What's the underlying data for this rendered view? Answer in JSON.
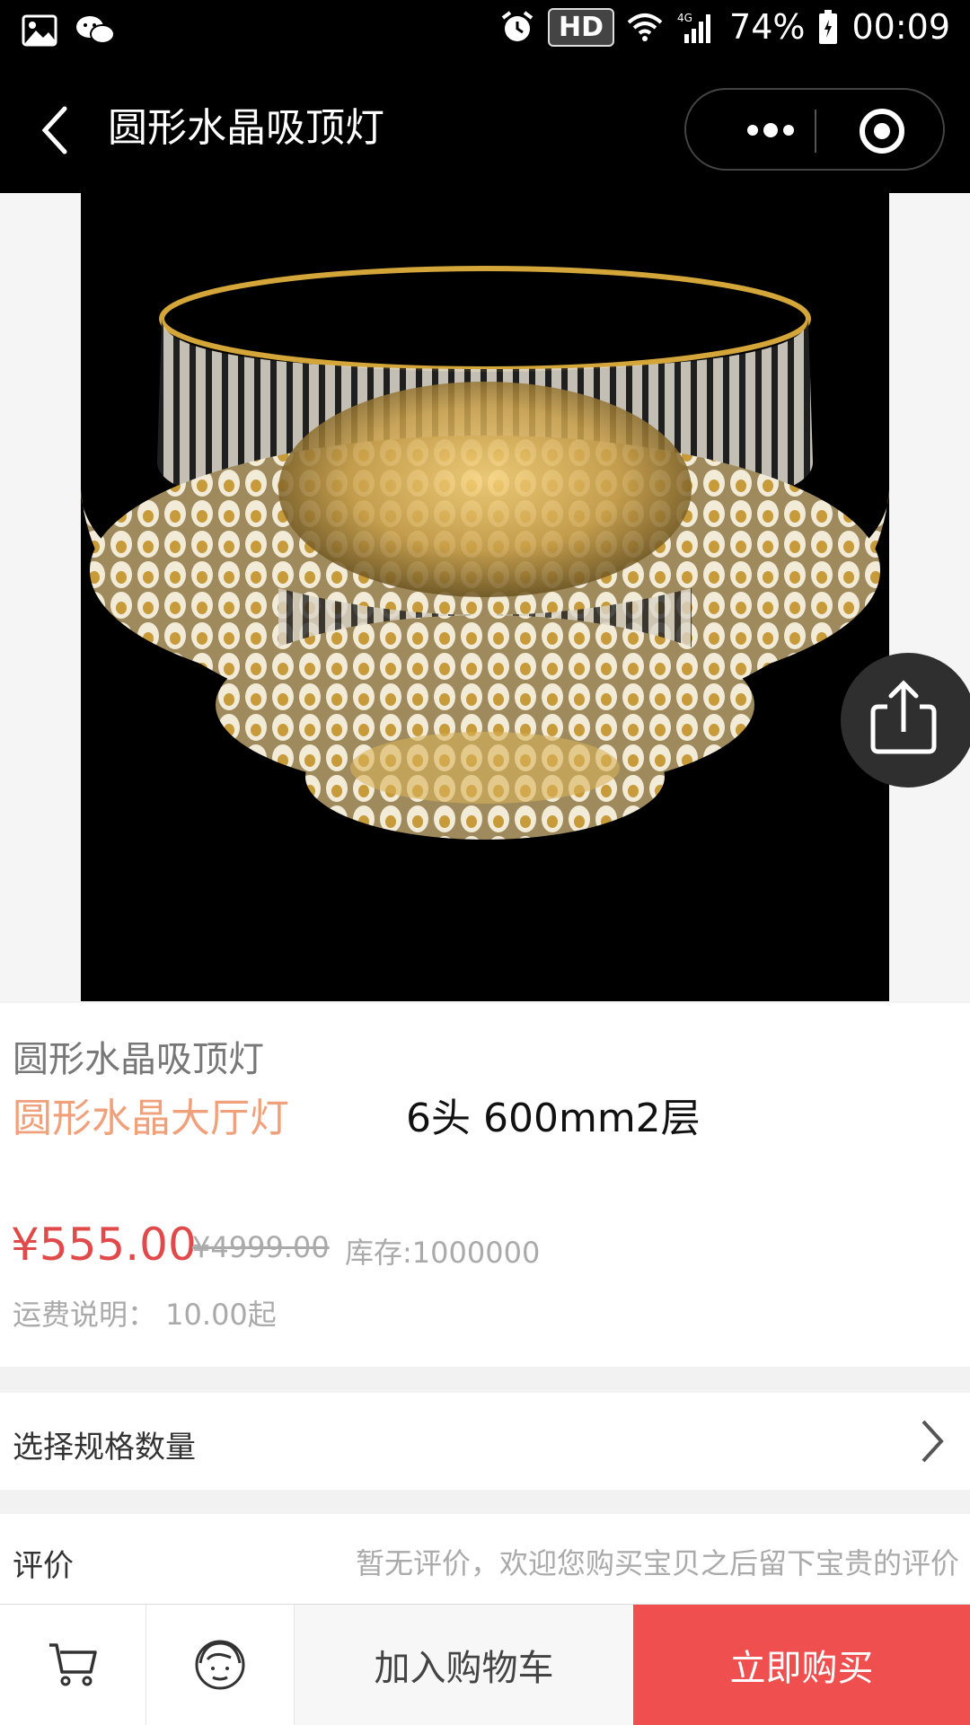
{
  "status_bar": {
    "hd_label": "HD",
    "network": "4G",
    "battery": "74%",
    "time": "00:09"
  },
  "nav": {
    "title": "圆形水晶吸顶灯"
  },
  "product": {
    "name": "圆形水晶吸顶灯",
    "subtitle": "圆形水晶大厅灯",
    "spec": "6头  600mm2层",
    "price": "¥555.00",
    "original_price": "¥4999.00",
    "stock": "库存:1000000",
    "shipping": "运费说明： 10.00起"
  },
  "spec_row": {
    "label": "选择规格数量"
  },
  "review_row": {
    "label": "评价",
    "message": "暂无评价，欢迎您购买宝贝之后留下宝贵的评价"
  },
  "bottom_bar": {
    "add_to_cart": "加入购物车",
    "buy_now": "立即购买"
  },
  "icons": [
    "image-icon",
    "wechat-icon",
    "alarm-icon",
    "wifi-icon",
    "signal-icon",
    "battery-icon",
    "back-icon",
    "more-icon",
    "target-icon",
    "share-icon",
    "cart-icon",
    "customer-service-icon",
    "chevron-right-icon"
  ],
  "colors": {
    "accent_red": "#ef4f4f",
    "price_red": "#e04a4a",
    "subtitle_orange": "#f0a07a"
  }
}
